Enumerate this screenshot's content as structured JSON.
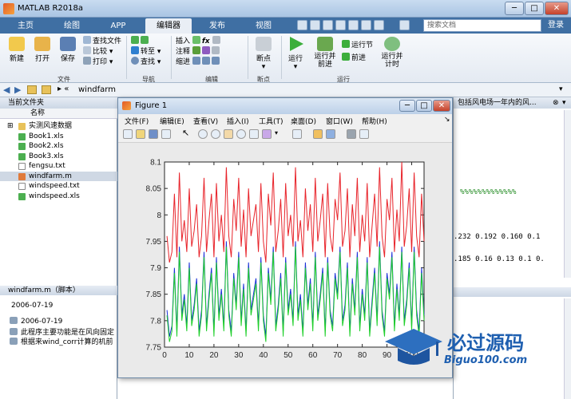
{
  "app": {
    "title": "MATLAB R2018a",
    "search_placeholder": "搜索文档",
    "login": "登录"
  },
  "window_controls": {
    "minimize": "─",
    "maximize": "□",
    "close": "✕"
  },
  "tabs": [
    {
      "label": "主页"
    },
    {
      "label": "绘图"
    },
    {
      "label": "APP"
    },
    {
      "label": "编辑器"
    },
    {
      "label": "发布"
    },
    {
      "label": "视图"
    }
  ],
  "ribbon": {
    "file": {
      "new": "新建",
      "open": "打开",
      "save": "保存",
      "find_files": "查找文件",
      "compare": "比较",
      "print": "打印",
      "group": "文件"
    },
    "navigate": {
      "goto": "转至",
      "find": "查找",
      "group": "导航"
    },
    "edit": {
      "insert": "插入",
      "comment": "注释",
      "indent": "缩进",
      "fx": "fx",
      "group": "编辑"
    },
    "breakpoints": {
      "breakpoints": "断点",
      "group": "断点"
    },
    "run": {
      "run": "运行",
      "run_advance": "运行并前进",
      "run_section": "运行节",
      "advance": "前进",
      "run_time": "运行并计时",
      "group": "运行"
    }
  },
  "address": {
    "path": "windfarm"
  },
  "current_folder": {
    "header": "当前文件夹",
    "column": "名称",
    "files": [
      {
        "name": "实测风速数据",
        "type": "folder"
      },
      {
        "name": "Book1.xls",
        "type": "xls"
      },
      {
        "name": "Book2.xls",
        "type": "xls"
      },
      {
        "name": "Book3.xls",
        "type": "xls"
      },
      {
        "name": "fengsu.txt",
        "type": "txt"
      },
      {
        "name": "windfarm.m",
        "type": "m"
      },
      {
        "name": "windspeed.txt",
        "type": "txt"
      },
      {
        "name": "windspeed.xls",
        "type": "xls"
      }
    ]
  },
  "details": {
    "header": "windfarm.m（脚本）",
    "date": "2006-07-19",
    "items": [
      {
        "text": "2006-07-19"
      },
      {
        "text": "此程序主要功能是在风向固定"
      },
      {
        "text": "根据来wind_corr计算的机前"
      }
    ]
  },
  "editor": {
    "header_text": "包括风电场一年内的风...",
    "percent_line": "%%%%%%%%%%%%%",
    "line1": ".232 0.192 0.160 0.1",
    "line2": ".185 0.16 0.13 0.1 0."
  },
  "figure": {
    "title": "Figure 1",
    "menu": [
      "文件(F)",
      "编辑(E)",
      "查看(V)",
      "插入(I)",
      "工具(T)",
      "桌面(D)",
      "窗口(W)",
      "帮助(H)"
    ]
  },
  "watermark": {
    "main": "必过源码",
    "sub": "Biguo100.com"
  },
  "colors": {
    "series_red": "#e8232a",
    "series_blue": "#1a2fd8",
    "series_green": "#1fd02a",
    "ribbon_blue": "#3f6fa3"
  },
  "chart_data": {
    "type": "line",
    "xlim": [
      0,
      105
    ],
    "ylim": [
      7.75,
      8.1
    ],
    "x_ticks": [
      0,
      10,
      20,
      30,
      40,
      50,
      60,
      70,
      80,
      90,
      100
    ],
    "y_ticks": [
      7.75,
      7.8,
      7.85,
      7.9,
      7.95,
      8,
      8.05,
      8.1
    ],
    "y_tick_labels": [
      "7.75",
      "7.8",
      "7.85",
      "7.9",
      "7.95",
      "8",
      "8.05",
      "8.1"
    ],
    "grid": false,
    "x": [
      1,
      2,
      3,
      4,
      5,
      6,
      7,
      8,
      9,
      10,
      11,
      12,
      13,
      14,
      15,
      16,
      17,
      18,
      19,
      20,
      21,
      22,
      23,
      24,
      25,
      26,
      27,
      28,
      29,
      30,
      31,
      32,
      33,
      34,
      35,
      36,
      37,
      38,
      39,
      40,
      41,
      42,
      43,
      44,
      45,
      46,
      47,
      48,
      49,
      50,
      51,
      52,
      53,
      54,
      55,
      56,
      57,
      58,
      59,
      60,
      61,
      62,
      63,
      64,
      65,
      66,
      67,
      68,
      69,
      70,
      71,
      72,
      73,
      74,
      75,
      76,
      77,
      78,
      79,
      80,
      81,
      82,
      83,
      84,
      85,
      86,
      87,
      88,
      89,
      90,
      91,
      92,
      93,
      94,
      95,
      96,
      97,
      98,
      99,
      100,
      101,
      102,
      103,
      104,
      105
    ],
    "series": [
      {
        "values": [
          7.96,
          7.91,
          7.93,
          8.04,
          7.92,
          8.08,
          7.95,
          7.99,
          7.93,
          8.05,
          7.94,
          7.97,
          8.02,
          7.92,
          7.96,
          8.07,
          7.93,
          7.99,
          8.04,
          7.92,
          8.06,
          7.95,
          8.0,
          7.93,
          8.09,
          7.96,
          7.92,
          8.03,
          7.97,
          8.07,
          7.94,
          8.01,
          7.92,
          8.05,
          7.96,
          7.99,
          8.02,
          7.93,
          8.06,
          7.95,
          7.91,
          8.04,
          7.98,
          8.08,
          7.93,
          7.97,
          8.03,
          7.92,
          8.06,
          7.96,
          8.0,
          7.94,
          8.09,
          7.95,
          7.99,
          7.92,
          8.05,
          7.97,
          8.02,
          7.93,
          8.07,
          7.95,
          7.99,
          8.04,
          7.92,
          8.06,
          7.96,
          7.93,
          8.03,
          7.99,
          8.08,
          7.94,
          7.97,
          8.05,
          7.92,
          8.02,
          7.96,
          8.07,
          7.93,
          8.0,
          7.95,
          8.06,
          7.92,
          7.98,
          8.04,
          7.94,
          8.09,
          7.96,
          7.92,
          8.03,
          7.99,
          8.07,
          7.93,
          8.01,
          7.95,
          8.1,
          7.94,
          7.98,
          8.05,
          7.93,
          8.08,
          7.96,
          7.92,
          8.04,
          7.95
        ]
      },
      {
        "values": [
          7.82,
          7.77,
          7.79,
          7.9,
          7.78,
          7.94,
          7.81,
          7.85,
          7.79,
          7.91,
          7.8,
          7.83,
          7.88,
          7.78,
          7.82,
          7.93,
          7.79,
          7.85,
          7.9,
          7.78,
          7.92,
          7.81,
          7.86,
          7.79,
          7.95,
          7.82,
          7.78,
          7.89,
          7.83,
          7.93,
          7.8,
          7.87,
          7.78,
          7.91,
          7.82,
          7.85,
          7.88,
          7.79,
          7.92,
          7.81,
          7.77,
          7.9,
          7.84,
          7.94,
          7.79,
          7.83,
          7.89,
          7.78,
          7.92,
          7.82,
          7.86,
          7.8,
          7.95,
          7.81,
          7.85,
          7.78,
          7.91,
          7.83,
          7.88,
          7.79,
          7.93,
          7.81,
          7.85,
          7.9,
          7.78,
          7.92,
          7.82,
          7.79,
          7.89,
          7.85,
          7.94,
          7.8,
          7.83,
          7.91,
          7.78,
          7.88,
          7.82,
          7.93,
          7.79,
          7.86,
          7.81,
          7.92,
          7.78,
          7.84,
          7.9,
          7.8,
          7.95,
          7.82,
          7.78,
          7.89,
          7.85,
          7.93,
          7.79,
          7.87,
          7.81,
          7.94,
          7.8,
          7.84,
          7.91,
          7.79,
          7.94,
          7.82,
          7.78,
          7.9,
          7.81
        ]
      },
      {
        "values": [
          7.81,
          7.76,
          7.78,
          7.89,
          7.77,
          7.93,
          7.8,
          7.84,
          7.78,
          7.9,
          7.79,
          7.82,
          7.87,
          7.77,
          7.81,
          7.92,
          7.78,
          7.84,
          7.89,
          7.77,
          7.91,
          7.8,
          7.85,
          7.78,
          7.94,
          7.81,
          7.77,
          7.88,
          7.82,
          7.92,
          7.79,
          7.86,
          7.77,
          7.9,
          7.81,
          7.84,
          7.87,
          7.78,
          7.91,
          7.8,
          7.76,
          7.89,
          7.83,
          7.93,
          7.78,
          7.82,
          7.88,
          7.77,
          7.91,
          7.81,
          7.85,
          7.79,
          7.94,
          7.8,
          7.84,
          7.77,
          7.9,
          7.82,
          7.87,
          7.78,
          7.92,
          7.8,
          7.84,
          7.89,
          7.77,
          7.91,
          7.81,
          7.78,
          7.88,
          7.84,
          7.93,
          7.79,
          7.82,
          7.9,
          7.77,
          7.87,
          7.81,
          7.92,
          7.78,
          7.85,
          7.8,
          7.91,
          7.77,
          7.83,
          7.89,
          7.79,
          7.94,
          7.81,
          7.77,
          7.88,
          7.84,
          7.92,
          7.78,
          7.86,
          7.8,
          7.93,
          7.79,
          7.83,
          7.9,
          7.78,
          7.93,
          7.81,
          7.77,
          7.89,
          7.8
        ]
      }
    ]
  }
}
